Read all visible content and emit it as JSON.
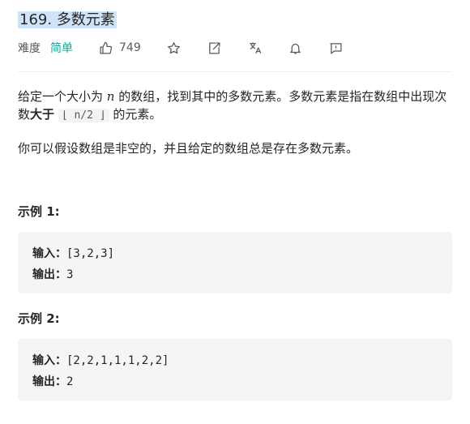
{
  "problem": {
    "number": "169.",
    "title": "多数元素",
    "difficulty_label": "难度",
    "difficulty": "简单",
    "likes": "749",
    "difficulty_color": "#00af9b"
  },
  "toolbar": {
    "icons": [
      "thumb-up-icon",
      "star-icon",
      "share-icon",
      "translate-icon",
      "bell-icon",
      "feedback-icon"
    ]
  },
  "description": {
    "p1_a": "给定一个大小为 ",
    "p1_n": "n",
    "p1_b": " 的数组，找到其中的多数元素。多数元素是指在数组中出现次数",
    "p1_bold": "大于",
    "p1_code": "⌊ n/2 ⌋",
    "p1_c": " 的元素。",
    "p2": "你可以假设数组是非空的，并且给定的数组总是存在多数元素。"
  },
  "examples": [
    {
      "title": "示例 1:",
      "input_label": "输入：",
      "input": "[3,2,3]",
      "output_label": "输出：",
      "output": "3"
    },
    {
      "title": "示例 2:",
      "input_label": "输入：",
      "input": "[2,2,1,1,1,2,2]",
      "output_label": "输出：",
      "output": "2"
    }
  ]
}
